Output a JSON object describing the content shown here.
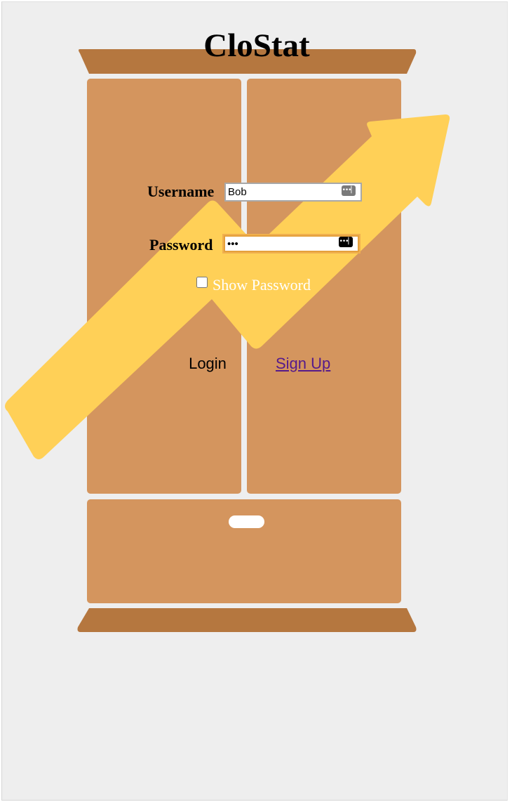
{
  "app": {
    "title": "CloStat"
  },
  "form": {
    "username_label": "Username",
    "username_value": "Bob",
    "password_label": "Password",
    "password_value": "abc",
    "show_password_label": "Show Password",
    "show_password_checked": false,
    "login_label": "Login",
    "signup_label": "Sign Up"
  },
  "icons": {
    "password_key": "•••▏"
  },
  "colors": {
    "page_background": "#eeeeee",
    "wardrobe_trim": "#b5773f",
    "wardrobe_body": "#d4955e",
    "arrow": "#ffd057",
    "link": "#551a8b",
    "focus_ring": "#f0b04e"
  }
}
